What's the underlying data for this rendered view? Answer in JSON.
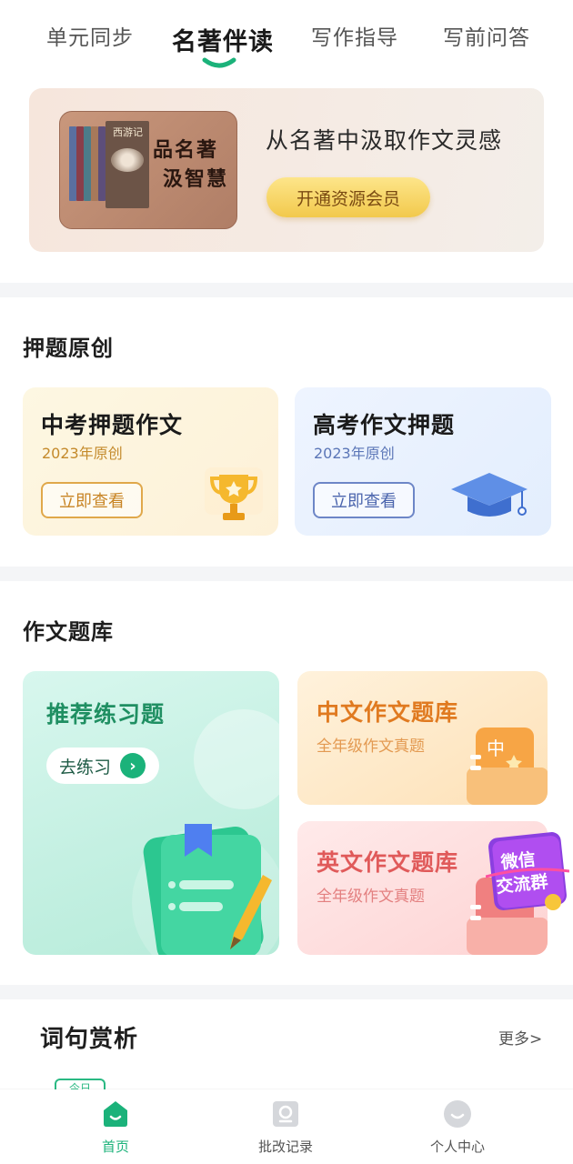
{
  "tabs": [
    {
      "label": "单元同步",
      "active": false
    },
    {
      "label": "名著伴读",
      "active": true
    },
    {
      "label": "写作指导",
      "active": false
    },
    {
      "label": "写前问答",
      "active": false
    }
  ],
  "banner": {
    "image_text_line1": "品名著",
    "image_text_line2": "汲智慧",
    "book_title": "西游记",
    "title": "从名著中汲取作文灵感",
    "button": "开通资源会员"
  },
  "predict_section": {
    "title": "押题原创",
    "cards": [
      {
        "title": "中考押题作文",
        "subtitle": "2023年原创",
        "button": "立即查看",
        "icon": "trophy-icon"
      },
      {
        "title": "高考作文押题",
        "subtitle": "2023年原创",
        "button": "立即查看",
        "icon": "graduation-cap-icon"
      }
    ]
  },
  "bank_section": {
    "title": "作文题库",
    "recommend": {
      "title": "推荐练习题",
      "button": "去练习",
      "icon": "notebook-pencil-icon"
    },
    "chinese": {
      "title": "中文作文题库",
      "subtitle": "全年级作文真题",
      "badge": "中"
    },
    "english": {
      "title": "英文作文题库",
      "subtitle": "全年级作文真题"
    },
    "wechat_badge": {
      "line1": "微信",
      "line2": "交流群"
    }
  },
  "phrase_section": {
    "title": "词句赏析",
    "more": "更多>",
    "peek_tag": "今日"
  },
  "bottom_nav": [
    {
      "label": "首页",
      "icon": "home-icon",
      "active": true
    },
    {
      "label": "批改记录",
      "icon": "record-icon",
      "active": false
    },
    {
      "label": "个人中心",
      "icon": "profile-icon",
      "active": false
    }
  ],
  "colors": {
    "accent_green": "#1bb27a",
    "banner_button": "#f2c94c"
  }
}
